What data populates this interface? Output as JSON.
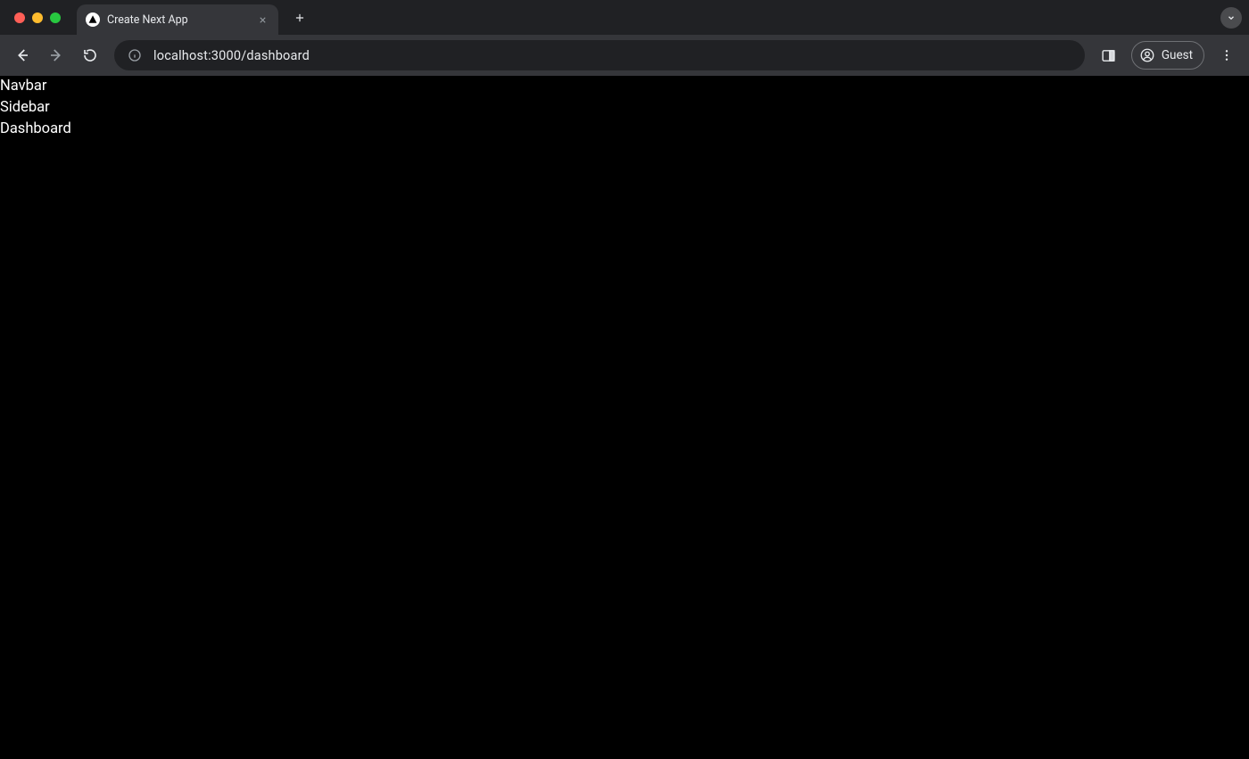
{
  "browser": {
    "tab": {
      "title": "Create Next App"
    },
    "url": "localhost:3000/dashboard",
    "profile_label": "Guest"
  },
  "page": {
    "lines": {
      "navbar": "Navbar",
      "sidebar": "Sidebar",
      "dashboard": "Dashboard"
    }
  }
}
